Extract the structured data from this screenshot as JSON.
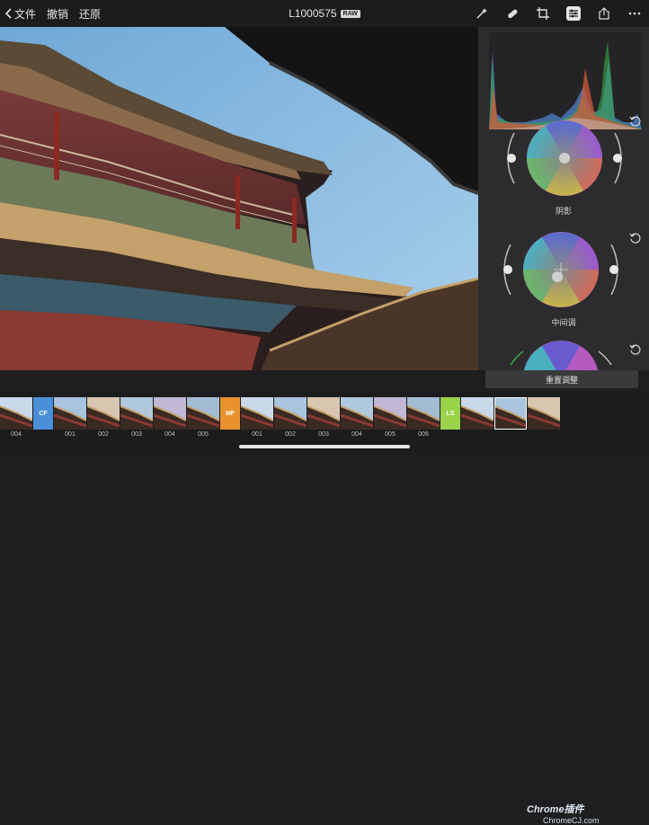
{
  "header": {
    "back_label": "文件",
    "undo_label": "撤销",
    "restore_label": "还原",
    "filename": "L1000575",
    "format_badge": "RAW",
    "icons": [
      "magic-wand-icon",
      "bandage-icon",
      "crop-icon",
      "adjust-sliders-icon",
      "share-icon",
      "more-icon"
    ]
  },
  "panel": {
    "wheels": [
      {
        "label": "阴影"
      },
      {
        "label": "中间调"
      },
      {
        "label": ""
      }
    ],
    "reset_button": "重置调整"
  },
  "filmstrip": {
    "groups": [
      {
        "tag": "",
        "tag_color": "",
        "labels": [
          "004"
        ]
      },
      {
        "tag": "CF",
        "tag_color": "#4a90d9",
        "labels": [
          "001",
          "002",
          "003",
          "004",
          "005"
        ]
      },
      {
        "tag": "MF",
        "tag_color": "#e8912d",
        "labels": [
          "001",
          "002",
          "003",
          "004",
          "005",
          "006"
        ]
      },
      {
        "tag": "LS",
        "tag_color": "#9ad24a",
        "labels": [
          "",
          "",
          ""
        ]
      }
    ]
  },
  "watermark": {
    "line1": "Chrome插件",
    "line2": "ChromeCJ.com"
  }
}
